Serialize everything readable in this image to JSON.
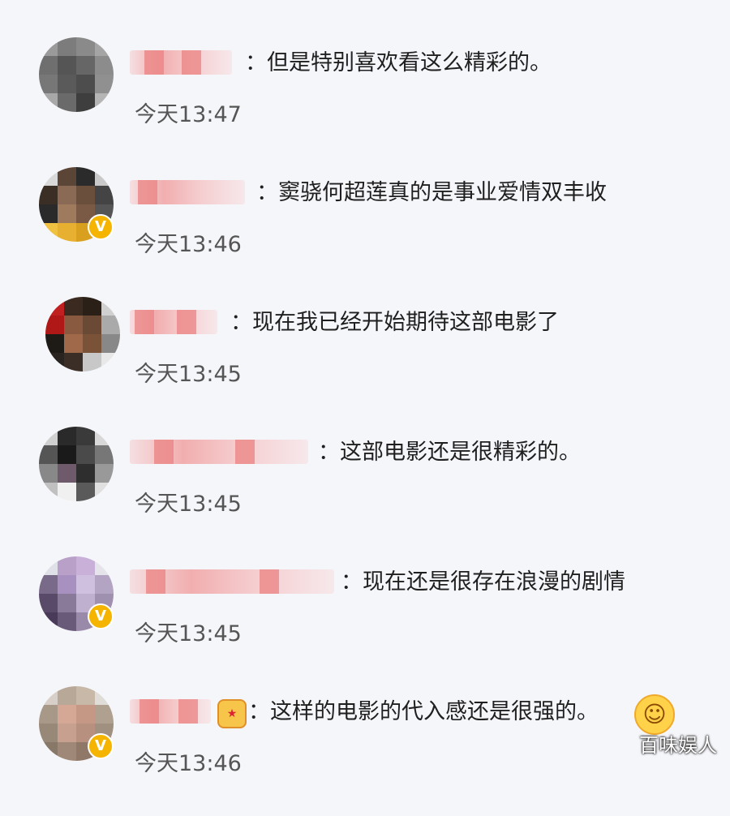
{
  "comments": [
    {
      "text": "：但是特别喜欢看这么精彩的。",
      "time": "今天13:47",
      "verified": false
    },
    {
      "text": "：窦骁何超莲真的是事业爱情双丰收",
      "time": "今天13:46",
      "verified": true
    },
    {
      "text": "：现在我已经开始期待这部电影了",
      "time": "今天13:45",
      "verified": false
    },
    {
      "text": "：这部电影还是很精彩的。",
      "time": "今天13:45",
      "verified": false
    },
    {
      "text": "：现在还是很存在浪漫的剧情",
      "time": "今天13:45",
      "verified": true
    },
    {
      "text": "：这样的电影的代入感还是很强的。",
      "time": "今天13:46",
      "verified": true
    }
  ],
  "verified_mark": "V",
  "watermark": "百味娱人"
}
